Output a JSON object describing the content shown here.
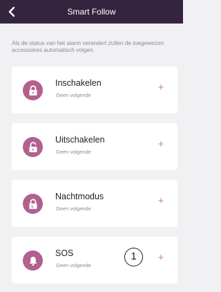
{
  "header": {
    "title": "Smart Follow",
    "back_icon": "chevron-left-icon"
  },
  "description": "Als de status van het alarm verandert zullen de toegewezen accessoires automatisch volgen.",
  "modes": [
    {
      "label": "Inschakelen",
      "sub": "Geen volgende",
      "icon": "lock-closed-icon",
      "action": "+"
    },
    {
      "label": "Uitschakelen",
      "sub": "Geen volgende",
      "icon": "lock-open-icon",
      "action": "+"
    },
    {
      "label": "Nachtmodus",
      "sub": "Geen volgende",
      "icon": "lock-night-icon",
      "action": "+"
    },
    {
      "label": "SOS",
      "sub": "Geen volgende",
      "icon": "bell-icon",
      "action": "+"
    }
  ],
  "annotation": "1",
  "colors": {
    "header_bg": "#34243f",
    "accent": "#b2608d",
    "plus": "#c77aa5"
  }
}
